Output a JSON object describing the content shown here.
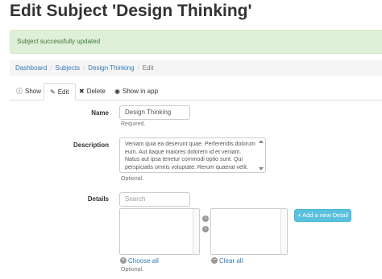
{
  "page_title": "Edit Subject 'Design Thinking'",
  "alert": {
    "text": "Subject successfully updated",
    "color": "#dff0d8"
  },
  "breadcrumb": [
    {
      "label": "Dashboard"
    },
    {
      "label": "Subjects"
    },
    {
      "label": "Design Thinking"
    },
    {
      "label": "Edit"
    }
  ],
  "tabs": [
    {
      "label": "Show",
      "icon": "info-icon",
      "glyph": "ⓘ"
    },
    {
      "label": "Edit",
      "icon": "pencil-icon",
      "glyph": "✎"
    },
    {
      "label": "Delete",
      "icon": "close-icon",
      "glyph": "✖"
    },
    {
      "label": "Show in app",
      "icon": "eye-icon",
      "glyph": "◉"
    }
  ],
  "form": {
    "name": {
      "label": "Name",
      "value": "Design Thinking",
      "help": "Required."
    },
    "description": {
      "label": "Description",
      "value": "Veniam quia ea deserunt quae. Perferendis dolorum eum. Aut itaque maiores dolorem id et veniam. Natus aut ipsa tenetur commodi optio sunt. Qui perspiciatis omnis voluptate. Rerum quaerat velit.",
      "help": "Optional."
    },
    "details": {
      "label": "Details",
      "search_placeholder": "Search",
      "move_right_glyph": "›",
      "move_left_glyph": "‹",
      "choose_all": "Choose all",
      "clear_all": "Clear all",
      "add_button": "Add a new Detail",
      "add_button_glyph": "+",
      "help": "Optional."
    }
  }
}
